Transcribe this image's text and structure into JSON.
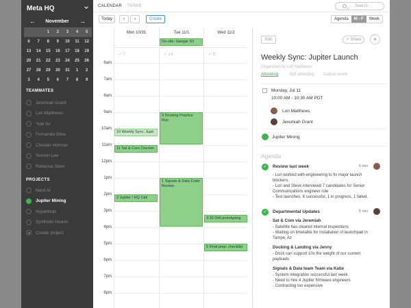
{
  "sidebar": {
    "brand": "Meta HQ",
    "calendar": {
      "month": "November",
      "weeks": [
        [
          {
            "d": "",
            "dim": true
          },
          {
            "d": "",
            "dim": true
          },
          {
            "d": "1"
          },
          {
            "d": "2"
          },
          {
            "d": "3"
          },
          {
            "d": "4"
          },
          {
            "d": "5"
          }
        ],
        [
          {
            "d": "6"
          },
          {
            "d": "7"
          },
          {
            "d": "8"
          },
          {
            "d": "9"
          },
          {
            "d": "10"
          },
          {
            "d": "11"
          },
          {
            "d": "12"
          }
        ],
        [
          {
            "d": "13"
          },
          {
            "d": "14"
          },
          {
            "d": "15"
          },
          {
            "d": "16"
          },
          {
            "d": "17"
          },
          {
            "d": "18"
          },
          {
            "d": "19"
          }
        ],
        [
          {
            "d": "20"
          },
          {
            "d": "21"
          },
          {
            "d": "22"
          },
          {
            "d": "23"
          },
          {
            "d": "24"
          },
          {
            "d": "25"
          },
          {
            "d": "26"
          }
        ],
        [
          {
            "d": "27"
          },
          {
            "d": "28"
          },
          {
            "d": "29"
          },
          {
            "d": "30"
          },
          {
            "d": "31"
          },
          {
            "d": "1"
          },
          {
            "d": "2"
          }
        ],
        [
          {
            "d": "3"
          },
          {
            "d": "4"
          },
          {
            "d": "5"
          },
          {
            "d": "6"
          },
          {
            "d": "7"
          },
          {
            "d": "8"
          },
          {
            "d": "9"
          }
        ]
      ]
    },
    "teammates_title": "TEAMMATES",
    "teammates": [
      "Jeremiah Grant",
      "Lori Matthews",
      "Yuki Ito",
      "Fernanda Silva",
      "Chester Hofman",
      "Vernon Lee",
      "Rebecca Stein"
    ],
    "projects_title": "PROJECTS",
    "projects": [
      {
        "name": "Nerd AI",
        "active": false
      },
      {
        "name": "Jupiter Mining",
        "active": true
      },
      {
        "name": "Hyperloop",
        "active": false
      },
      {
        "name": "Synthetic Hearts",
        "active": false
      }
    ],
    "create_project": "Create project"
  },
  "topbar": {
    "tab_calendar": "CALENDAR",
    "tab_tasks": "TASKS",
    "search_placeholder": "Search"
  },
  "toolbar": {
    "today": "Today",
    "create": "Create",
    "views": [
      "Agenda",
      "M - F",
      "Week"
    ],
    "active_view": "M - F"
  },
  "calendar": {
    "days": [
      "Mon 10/31",
      "Tue 11/1",
      "Wed 11/2"
    ],
    "day_checks": [
      "✓ 7",
      "✓ 14",
      "✓ 5"
    ],
    "hours": [
      "6am",
      "7am",
      "8am",
      "9am",
      "10am",
      "11am",
      "12pm",
      "1pm",
      "2pm",
      "3pm",
      "4pm",
      "5pm",
      "6pm",
      "7pm",
      "8pm"
    ],
    "allday_event": "On-site: Hangar XII",
    "events": [
      {
        "day": 0,
        "start": 10,
        "end": 10.5,
        "label": "10 Weekly Sync: Jupit",
        "light": true
      },
      {
        "day": 0,
        "start": 11,
        "end": 11.5,
        "label": "11 Sat & Com Checkin"
      },
      {
        "day": 0,
        "start": 14,
        "end": 14.5,
        "label": "2 Jupiter / HQ Call"
      },
      {
        "day": 1,
        "start": 9,
        "end": 11,
        "label": "9 Docking Practice Run"
      },
      {
        "day": 1,
        "start": 13,
        "end": 16,
        "label": "1 Signals & Data Code Review"
      },
      {
        "day": 2,
        "start": 15.25,
        "end": 15.75,
        "label": "3:30 Drill prototyping"
      },
      {
        "day": 2,
        "start": 17,
        "end": 17.5,
        "label": "5 Final prep: checklist"
      }
    ]
  },
  "panel": {
    "edit": "Edit",
    "share": "Share",
    "close": "×",
    "title": "Weekly Sync: Jupiter Launch",
    "organizer": "Organized by Lori Matthews",
    "rsvp": [
      "Attending",
      "Not attending",
      "Cancel event"
    ],
    "date": "Monday, Jul 11",
    "time": "10:00 AM - 10:30 AM PDT",
    "attendees": [
      "Lori Matthews",
      "Jeremiah Grant"
    ],
    "project": "Jupiter Mining",
    "agenda_title": "Agenda",
    "agenda": [
      {
        "title": "Review last week",
        "minutes": "5 min",
        "lines": [
          "- Lori worked with engineering to fix major launch",
          "blockers.",
          "- Lori and Steve interviewd 7 candidates for Senior",
          "Communications engineer role",
          "- Test launches: 6 successful, 1 in progress, 1 failed."
        ]
      },
      {
        "title": "Departmental Updates",
        "minutes": "5 min",
        "groups": [
          {
            "name": "Sat & Com via Jeremiah",
            "lines": [
              "- Satellite has cleared internal inspections",
              "- Waiting on timetable for installation of launchpad in",
              "Tampe, Az"
            ]
          },
          {
            "name": "Docking & Landing via Jenny",
            "lines": [
              "- Dock can support 10x the weight of our current",
              "payloads"
            ]
          },
          {
            "name": "Signals & Data team Team via Katie",
            "lines": [
              "- System integration successful last week",
              "- Need to hire 4 Jupiter firmware engineers",
              "- Contracting too expensive"
            ]
          }
        ]
      }
    ]
  },
  "colors": {
    "accent": "#3a8ee0",
    "green": "#3cb54a",
    "event": "#8ed08a",
    "sidebar": "#3a3a3a"
  }
}
